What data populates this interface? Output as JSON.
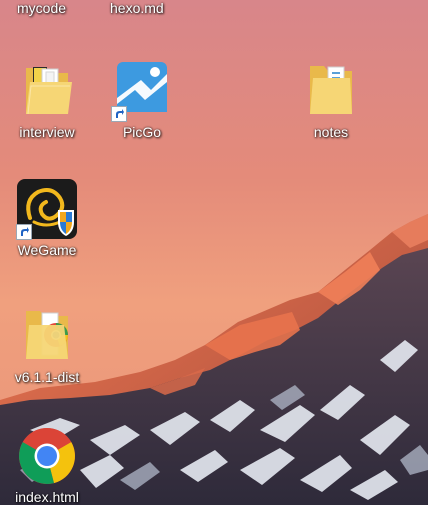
{
  "desktop": {
    "top_row": [
      {
        "label": "mycode"
      },
      {
        "label": "hexo.md"
      }
    ],
    "icons": [
      {
        "label": "interview",
        "icon": "folder-with-files-icon"
      },
      {
        "label": "PicGo",
        "icon": "picgo-app-icon",
        "shortcut": true
      },
      {
        "label": "notes",
        "icon": "folder-with-files-icon"
      },
      {
        "label": "WeGame",
        "icon": "wegame-app-icon",
        "shortcut": true
      },
      {
        "label": "v6.1.1-dist",
        "icon": "folder-with-files-icon"
      },
      {
        "label": "index.html",
        "icon": "chrome-icon"
      }
    ]
  }
}
